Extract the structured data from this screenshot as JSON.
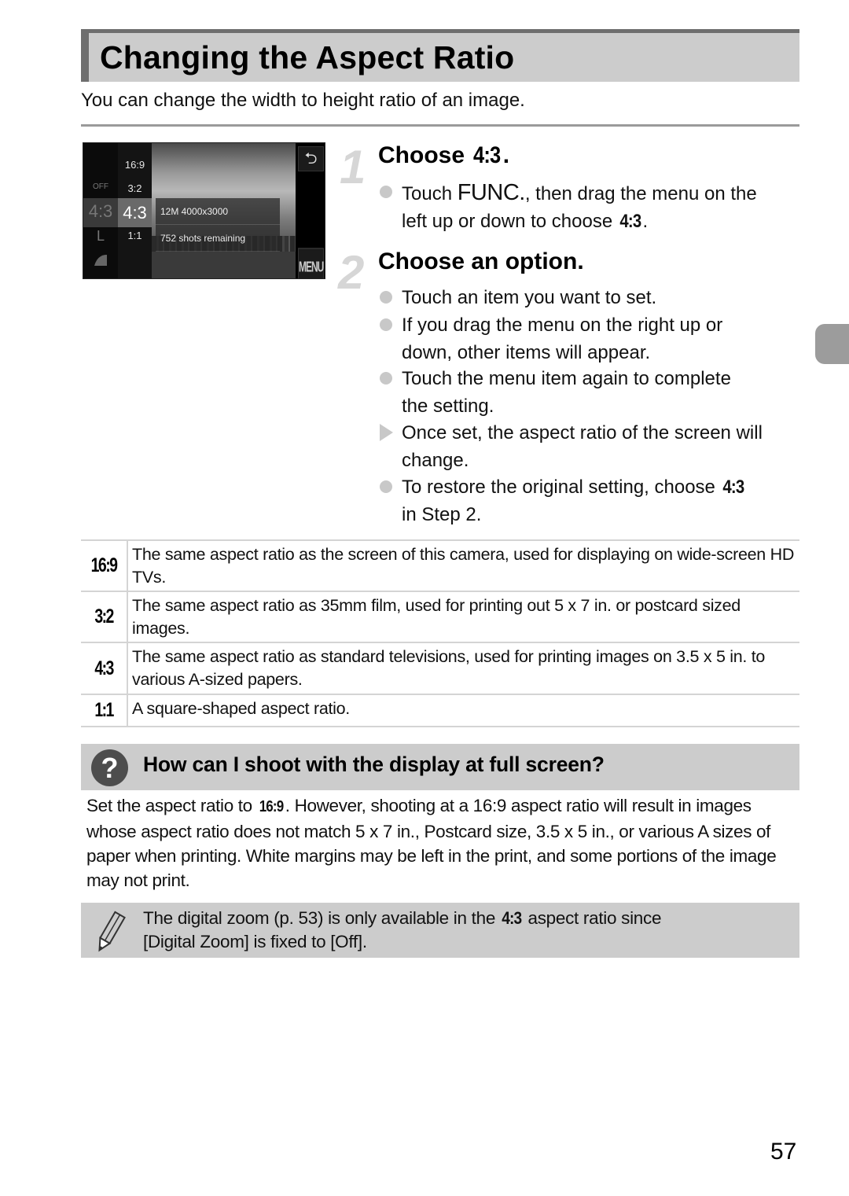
{
  "header": {
    "title": "Changing the Aspect Ratio",
    "intro": "You can change the width to height ratio of an image."
  },
  "camera_screen": {
    "left_column": [
      "OFF",
      "4:3",
      "L"
    ],
    "ratio_options": [
      "16:9",
      "3:2",
      "4:3",
      "1:1"
    ],
    "selected_ratio": "4:3",
    "info_resolution": "12M 4000x3000",
    "info_shots": "752 shots remaining",
    "back_icon": "return-arrow",
    "menu_label": "MENU"
  },
  "steps": [
    {
      "number": "1",
      "title_prefix": "Choose",
      "title_glyph": "4:3",
      "title_suffix": ".",
      "bullets": [
        {
          "type": "dot",
          "parts": [
            "Touch ",
            "FUNC.",
            ", then drag the menu on the",
            "left up or down to choose ",
            "4:3",
            "."
          ]
        }
      ]
    },
    {
      "number": "2",
      "title": "Choose an option.",
      "bullets": [
        {
          "type": "dot",
          "lines": [
            "Touch an item you want to set."
          ]
        },
        {
          "type": "dot",
          "lines": [
            "If you drag the menu on the right up or",
            "down, other items will appear."
          ]
        },
        {
          "type": "dot",
          "lines": [
            "Touch the menu item again to complete",
            "the setting."
          ]
        },
        {
          "type": "triangle",
          "lines": [
            "Once set, the aspect ratio of the screen will",
            "change."
          ]
        },
        {
          "type": "dot",
          "lines": [
            "To restore the original setting, choose ",
            "4:3",
            "in Step 2."
          ]
        }
      ]
    }
  ],
  "ratio_table": [
    {
      "ratio": "16:9",
      "description": "The same aspect ratio as the screen of this camera, used for displaying on wide-screen HD TVs."
    },
    {
      "ratio": "3:2",
      "description": "The same aspect ratio as 35mm film, used for printing out 5 x 7 in. or postcard sized images."
    },
    {
      "ratio": "4:3",
      "description": "The same aspect ratio as standard televisions, used for printing images on 3.5 x 5 in. to various A-sized papers."
    },
    {
      "ratio": "1:1",
      "description": "A square-shaped aspect ratio."
    }
  ],
  "faq": {
    "icon": "question-mark",
    "title": "How can I shoot with the display at full screen?",
    "body_prefix": "Set the aspect ratio to ",
    "body_glyph": "16:9",
    "body_suffix": ". However, shooting at a 16:9 aspect ratio will result in images whose aspect ratio does not match 5 x 7 in., Postcard size, 3.5 x 5 in., or various A sizes of paper when printing. White margins may be left in the print, and some portions of the image may not print."
  },
  "note": {
    "icon": "pencil",
    "text_prefix": "The digital zoom (p. 53) is only available in the ",
    "text_glyph": "4:3",
    "text_suffix": " aspect ratio since",
    "text_line2": "[Digital Zoom] is fixed to [Off]."
  },
  "page_number": "57",
  "colors": {
    "title_bar_bg": "#cccccc",
    "title_bar_border": "#6e6e6e",
    "bullet": "#c8c8c8",
    "side_tab": "#9c9c9c",
    "faq_icon": "#4d4d4d"
  }
}
